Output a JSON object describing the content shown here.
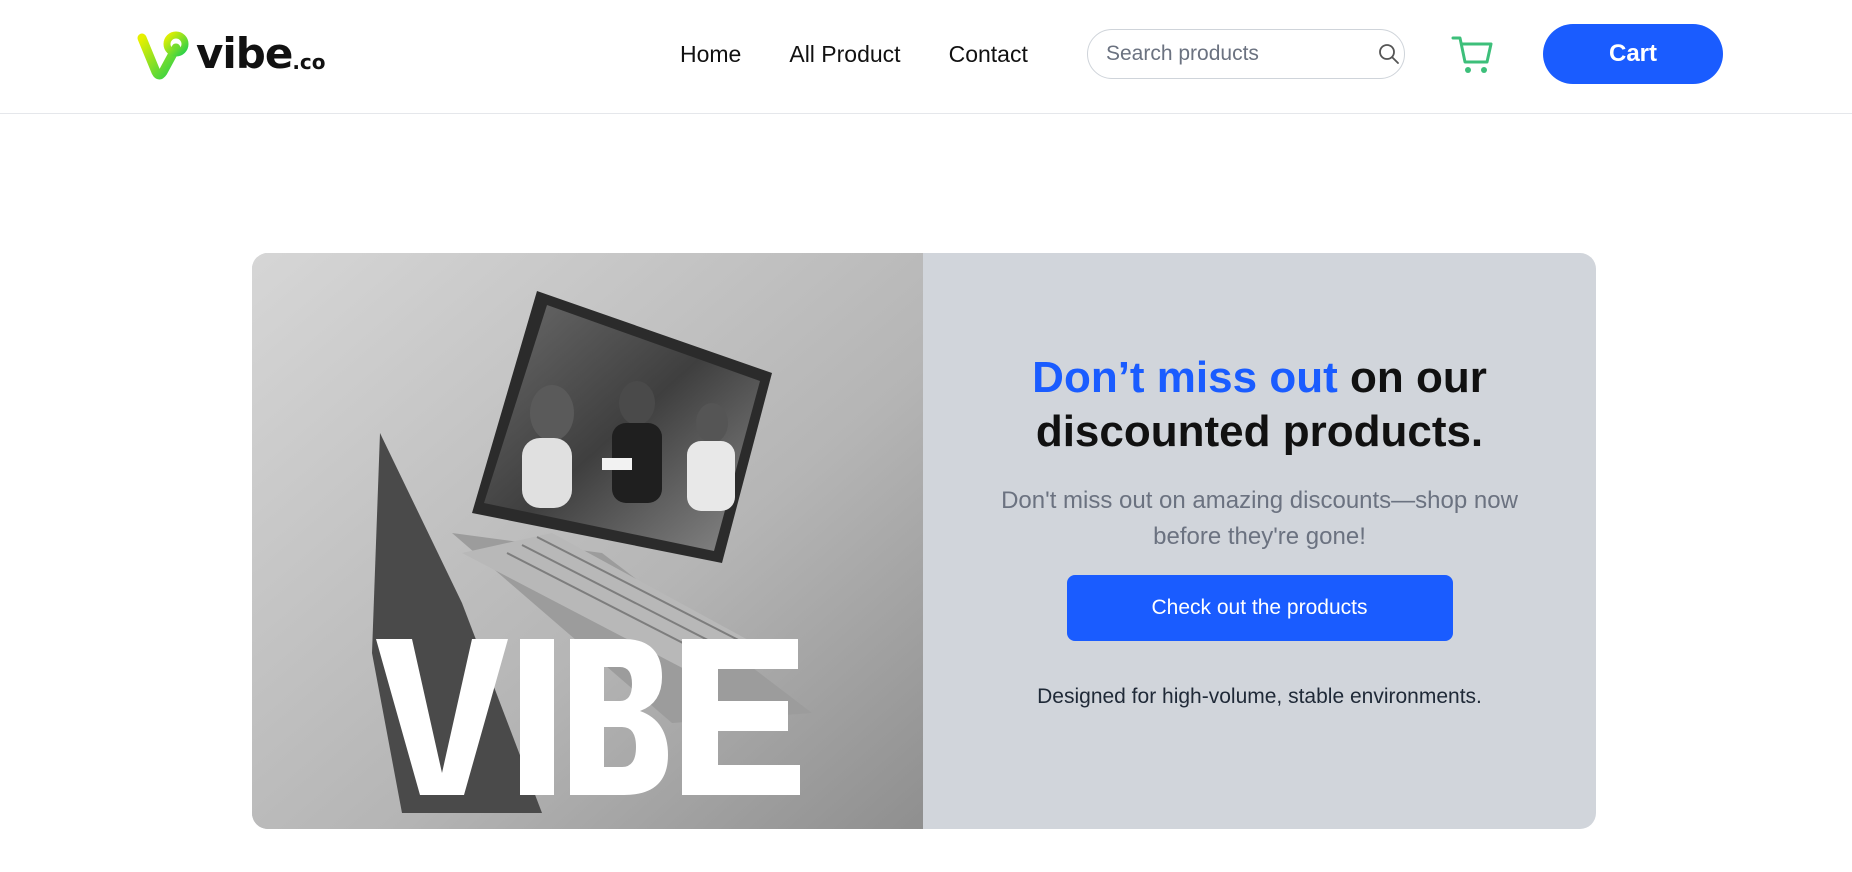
{
  "brand": {
    "name": "vibe",
    "tld": ".co"
  },
  "nav": {
    "items": [
      "Home",
      "All Product",
      "Contact"
    ]
  },
  "search": {
    "placeholder": "Search products",
    "icon": "search-icon"
  },
  "cart": {
    "icon": "cart-icon",
    "button_label": "Cart"
  },
  "banner": {
    "headline_accent": "Don’t miss out",
    "headline_rest": " on our discounted products.",
    "subtext": "Don't miss out on amazing discounts—shop now before they're gone!",
    "cta_label": "Check out the products",
    "tagline": "Designed for high-volume, stable environments.",
    "image_logo_text": "VIBE"
  },
  "colors": {
    "accent": "#1a5cff",
    "cart_icon": "#3dbf7a",
    "banner_bg": "#d1d5db"
  }
}
